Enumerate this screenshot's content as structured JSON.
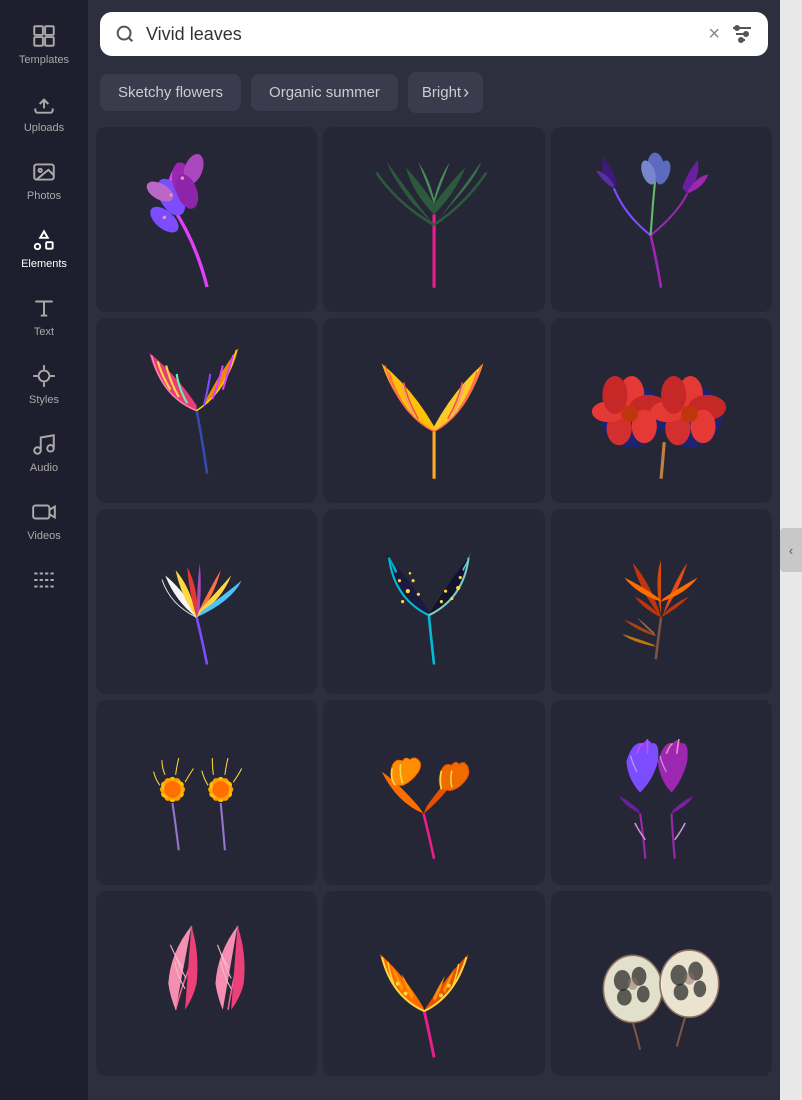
{
  "sidebar": {
    "items": [
      {
        "label": "Templates",
        "icon": "grid-icon"
      },
      {
        "label": "Uploads",
        "icon": "upload-icon"
      },
      {
        "label": "Photos",
        "icon": "photo-icon"
      },
      {
        "label": "Elements",
        "icon": "elements-icon"
      },
      {
        "label": "Text",
        "icon": "text-icon"
      },
      {
        "label": "Styles",
        "icon": "styles-icon"
      },
      {
        "label": "Audio",
        "icon": "audio-icon"
      },
      {
        "label": "Videos",
        "icon": "video-icon"
      },
      {
        "label": "Background",
        "icon": "background-icon"
      }
    ]
  },
  "search": {
    "value": "Vivid leaves",
    "placeholder": "Vivid leaves",
    "clear_label": "×",
    "filter_icon": "filter-icon"
  },
  "tags": [
    {
      "label": "Sketchy flowers",
      "id": "sketchy-flowers"
    },
    {
      "label": "Organic summer",
      "id": "organic-summer"
    },
    {
      "label": "Bright",
      "id": "bright"
    },
    {
      "label": "›",
      "id": "more"
    }
  ],
  "grid": {
    "rows": [
      [
        {
          "id": "leaf-purple-branch",
          "desc": "Purple leaf branch"
        },
        {
          "id": "leaf-dark-tropical",
          "desc": "Dark tropical leaves"
        },
        {
          "id": "leaf-purple-blue",
          "desc": "Purple blue flower stem"
        }
      ],
      [
        {
          "id": "leaf-colorful-tropical",
          "desc": "Colorful tropical leaf"
        },
        {
          "id": "leaf-yellow-big",
          "desc": "Large yellow leaves"
        },
        {
          "id": "leaf-red-flower",
          "desc": "Red flowers blue border"
        }
      ],
      [
        {
          "id": "leaf-feather-multi",
          "desc": "Multi-color feather leaves"
        },
        {
          "id": "leaf-dark-pointed",
          "desc": "Dark pointed leaves"
        },
        {
          "id": "leaf-amber-cluster",
          "desc": "Amber leaf cluster"
        }
      ],
      [
        {
          "id": "leaf-yellow-flower",
          "desc": "Yellow daisy flowers"
        },
        {
          "id": "leaf-orange-heart",
          "desc": "Orange heart leaves"
        },
        {
          "id": "leaf-purple-heart",
          "desc": "Purple heart leaves"
        }
      ],
      [
        {
          "id": "leaf-pink-feather",
          "desc": "Pink feather leaves"
        },
        {
          "id": "leaf-orange-tribal",
          "desc": "Orange tribal leaves"
        },
        {
          "id": "leaf-spotted-round",
          "desc": "Spotted round leaves"
        }
      ]
    ]
  },
  "collapse_btn_label": "‹"
}
